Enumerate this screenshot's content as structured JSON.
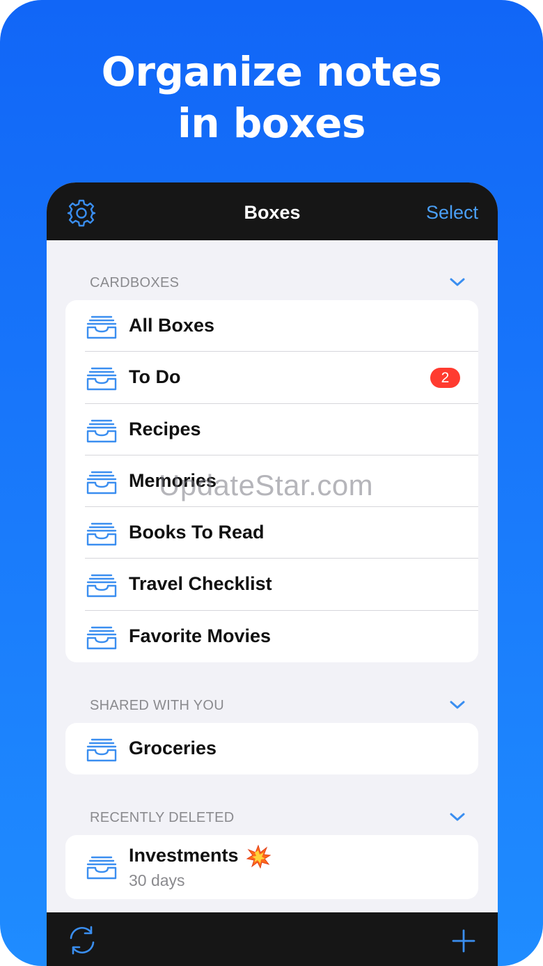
{
  "promo": {
    "headline_line1": "Organize notes",
    "headline_line2": "in boxes"
  },
  "navbar": {
    "title": "Boxes",
    "select_label": "Select",
    "settings_icon": "gear-icon"
  },
  "sections": {
    "cardboxes": {
      "header": "CARDBOXES",
      "items": [
        {
          "label": "All Boxes"
        },
        {
          "label": "To Do",
          "badge": "2"
        },
        {
          "label": "Recipes"
        },
        {
          "label": "Memories"
        },
        {
          "label": "Books To Read"
        },
        {
          "label": "Travel Checklist"
        },
        {
          "label": "Favorite Movies"
        }
      ]
    },
    "shared": {
      "header": "SHARED WITH YOU",
      "items": [
        {
          "label": "Groceries"
        }
      ]
    },
    "deleted": {
      "header": "RECENTLY DELETED",
      "items": [
        {
          "label": "Investments",
          "sublabel": "30 days",
          "emoji": "collision"
        }
      ]
    }
  },
  "toolbar": {
    "sync_icon": "sync-icon",
    "add_icon": "plus-icon"
  },
  "watermark": "UpdateStar.com",
  "colors": {
    "accent": "#4a9ff5",
    "badge": "#ff3b30",
    "promo_background": "#1a7bfb",
    "bar_background": "#161616",
    "list_background": "#f2f2f7"
  }
}
